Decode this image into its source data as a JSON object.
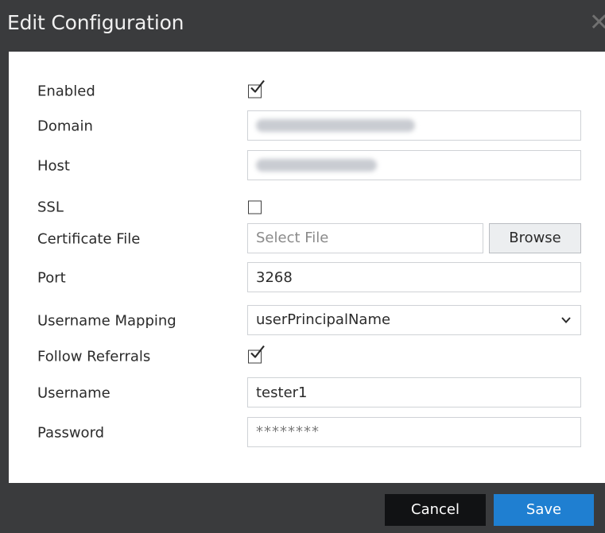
{
  "dialog": {
    "title": "Edit Configuration",
    "close_icon": "close-icon"
  },
  "form": {
    "enabled": {
      "label": "Enabled",
      "checked": true
    },
    "domain": {
      "label": "Domain",
      "value": ""
    },
    "host": {
      "label": "Host",
      "value": ""
    },
    "ssl": {
      "label": "SSL",
      "checked": false
    },
    "certificate_file": {
      "label": "Certificate File",
      "placeholder": "Select File",
      "browse_label": "Browse"
    },
    "port": {
      "label": "Port",
      "value": "3268"
    },
    "username_mapping": {
      "label": "Username Mapping",
      "selected": "userPrincipalName"
    },
    "follow_referrals": {
      "label": "Follow Referrals",
      "checked": true
    },
    "username": {
      "label": "Username",
      "value": "tester1"
    },
    "password": {
      "label": "Password",
      "value": "********"
    }
  },
  "footer": {
    "cancel_label": "Cancel",
    "save_label": "Save"
  },
  "colors": {
    "header_bg": "#3a3b3d",
    "primary_button": "#1f7fd1",
    "secondary_button": "#111214"
  }
}
